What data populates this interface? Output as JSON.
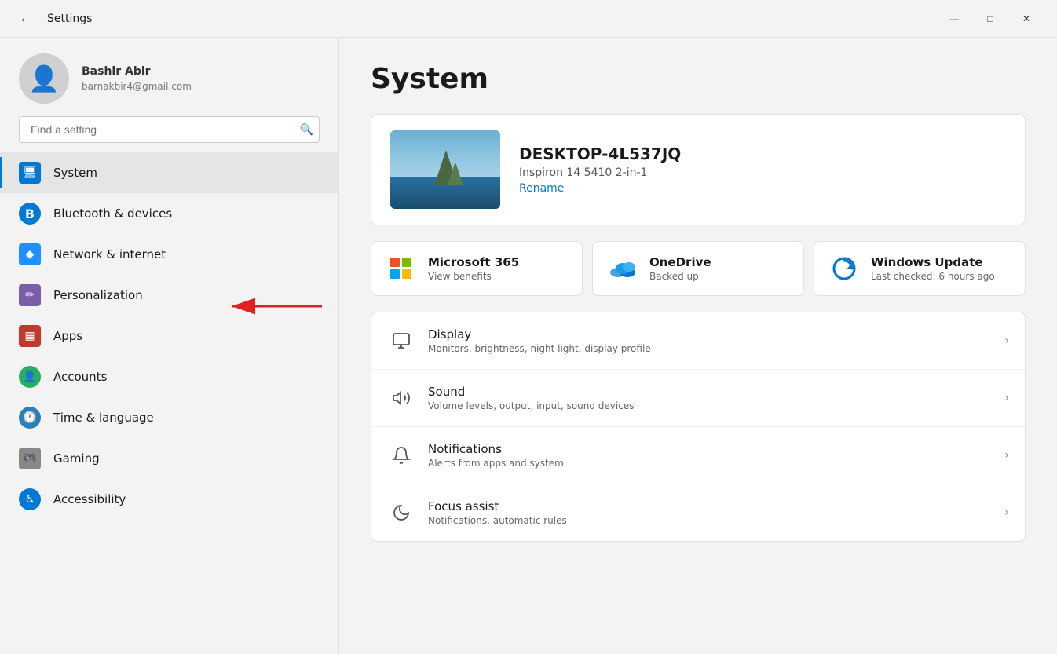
{
  "titleBar": {
    "title": "Settings",
    "backLabel": "←",
    "minimizeLabel": "—",
    "maximizeLabel": "□",
    "closeLabel": "✕"
  },
  "sidebar": {
    "user": {
      "name": "Bashir Abir",
      "email": "barnakbir4@gmail.com"
    },
    "search": {
      "placeholder": "Find a setting"
    },
    "navItems": [
      {
        "id": "system",
        "label": "System",
        "icon": "🖥",
        "active": true
      },
      {
        "id": "bluetooth",
        "label": "Bluetooth & devices",
        "icon": "🔵",
        "active": false
      },
      {
        "id": "network",
        "label": "Network & internet",
        "icon": "💎",
        "active": false
      },
      {
        "id": "personalization",
        "label": "Personalization",
        "icon": "✏️",
        "active": false
      },
      {
        "id": "apps",
        "label": "Apps",
        "icon": "📦",
        "active": false
      },
      {
        "id": "accounts",
        "label": "Accounts",
        "icon": "👤",
        "active": false
      },
      {
        "id": "timelang",
        "label": "Time & language",
        "icon": "🕐",
        "active": false
      },
      {
        "id": "gaming",
        "label": "Gaming",
        "icon": "🎮",
        "active": false
      },
      {
        "id": "accessibility",
        "label": "Accessibility",
        "icon": "♿",
        "active": false
      }
    ]
  },
  "content": {
    "pageTitle": "System",
    "device": {
      "name": "DESKTOP-4L537JQ",
      "model": "Inspiron 14 5410 2-in-1",
      "renameLabel": "Rename"
    },
    "quickLinks": [
      {
        "id": "ms365",
        "title": "Microsoft 365",
        "subtitle": "View benefits",
        "iconType": "ms365"
      },
      {
        "id": "onedrive",
        "title": "OneDrive",
        "subtitle": "Backed up",
        "iconType": "onedrive"
      },
      {
        "id": "winupdate",
        "title": "Windows Update",
        "subtitle": "Last checked: 6 hours ago",
        "iconType": "winupdate"
      }
    ],
    "settings": [
      {
        "id": "display",
        "icon": "🖥",
        "title": "Display",
        "subtitle": "Monitors, brightness, night light, display profile"
      },
      {
        "id": "sound",
        "icon": "🔊",
        "title": "Sound",
        "subtitle": "Volume levels, output, input, sound devices"
      },
      {
        "id": "notifications",
        "icon": "🔔",
        "title": "Notifications",
        "subtitle": "Alerts from apps and system"
      },
      {
        "id": "focus",
        "icon": "🌙",
        "title": "Focus assist",
        "subtitle": "Notifications, automatic rules"
      }
    ]
  },
  "arrow": {
    "pointing": "bluetooth-nav-item"
  }
}
